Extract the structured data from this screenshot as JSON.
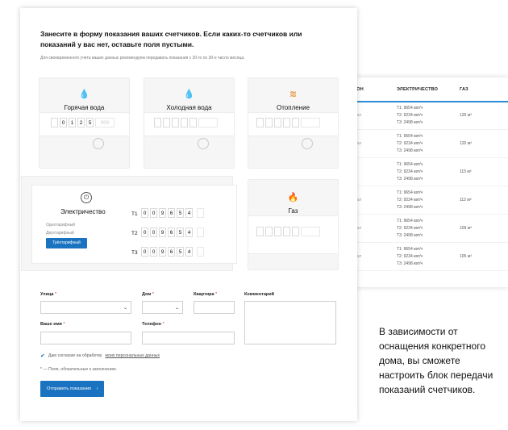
{
  "form": {
    "title": "Занесите в форму показания ваших счетчиков. Если каких-то счетчиков или показаний у вас нет, оставьте поля пустыми.",
    "subtitle": "Для своевременного учёта ваших данных рекомендуем передавать показания с 20-го по 30-е число месяца.",
    "meters": {
      "hot": {
        "name": "Горячая вода",
        "icon": "hot-water-drop-icon",
        "color": "#e8473d",
        "digits": [
          "",
          "0",
          "1",
          "2",
          "5"
        ],
        "fraction": [
          "0",
          "0",
          "0"
        ]
      },
      "cold": {
        "name": "Холодная вода",
        "icon": "cold-water-drop-icon",
        "color": "#2a8bd6",
        "digits": [
          "",
          "",
          "",
          "",
          ""
        ],
        "fraction": [
          "",
          "",
          ""
        ]
      },
      "heat": {
        "name": "Отопление",
        "icon": "heating-icon",
        "color": "#e9913a",
        "digits": [
          "",
          "",
          "",
          "",
          ""
        ],
        "fraction": [
          "",
          "",
          ""
        ]
      },
      "gas": {
        "name": "Газ",
        "icon": "gas-flame-icon",
        "color": "#2ec4d6"
      }
    },
    "electricity": {
      "name": "Электричество",
      "icon": "plug-icon",
      "modes": [
        "Однотарифный",
        "Двухтарифный",
        "Трёхтарифный"
      ],
      "active_mode": "Трёхтарифный",
      "rates": [
        {
          "label": "T1",
          "digits": [
            "0",
            "0",
            "9",
            "6",
            "5",
            "4"
          ]
        },
        {
          "label": "T2",
          "digits": [
            "0",
            "0",
            "9",
            "6",
            "5",
            "4"
          ]
        },
        {
          "label": "T3",
          "digits": [
            "0",
            "0",
            "9",
            "6",
            "5",
            "4"
          ]
        }
      ]
    },
    "fields": {
      "street": {
        "label": "Улица",
        "required": "*"
      },
      "house": {
        "label": "Дом",
        "required": "*"
      },
      "apartment": {
        "label": "Квартира",
        "required": "*"
      },
      "comment": {
        "label": "Комментарий"
      },
      "name": {
        "label": "Ваше имя",
        "required": "*"
      },
      "phone": {
        "label": "Телефон",
        "required": "*"
      }
    },
    "consent_text": "Даю согласие на обработку",
    "consent_link": "моих персональных данных",
    "required_note": "* — Поля, обязательные к заполнению.",
    "submit_label": "Отправить показания",
    "submit_arrow": "›"
  },
  "history": {
    "headers": [
      "ТЕЛЕФОН",
      "ЭЛЕКТРИЧЕСТВО",
      "ГАЗ"
    ],
    "header_visible": [
      "ТЕЛЕФОН",
      "ЭЛЕКТРИЧЕСТВО",
      "ГАЗ"
    ],
    "rows": [
      {
        "left": "кал",
        "t1": "T1: 9654 квт/ч",
        "t2": "T2: 9234 квт/ч",
        "t3": "T3: 2498 квт/ч",
        "gas": "125 м³"
      },
      {
        "left": "кал",
        "t1": "T1: 9654 квт/ч",
        "t2": "T2: 9234 квт/ч",
        "t3": "T3: 2498 квт/ч",
        "gas": "120 м³"
      },
      {
        "left": "",
        "t1": "T1: 9654 квт/ч",
        "t2": "T2: 9234 квт/ч",
        "t3": "T3: 2498 квт/ч",
        "gas": "115 м³"
      },
      {
        "left": "кал",
        "t1": "T1: 9654 квт/ч",
        "t2": "T2: 9234 квт/ч",
        "t3": "T3: 2498 квт/ч",
        "gas": "112 м³"
      },
      {
        "left": "кал",
        "t1": "T1: 9654 квт/ч",
        "t2": "T2: 9234 квт/ч",
        "t3": "T3: 2498 квт/ч",
        "gas": "109 м³"
      },
      {
        "left": "кал",
        "t1": "T1: 9654 квт/ч",
        "t2": "T2: 9234 квт/ч",
        "t3": "T3: 2498 квт/ч",
        "gas": "105 м³"
      }
    ]
  },
  "caption": "В зависимости от оснащения конкретного дома, вы сможете настроить блок передачи показаний счетчиков."
}
